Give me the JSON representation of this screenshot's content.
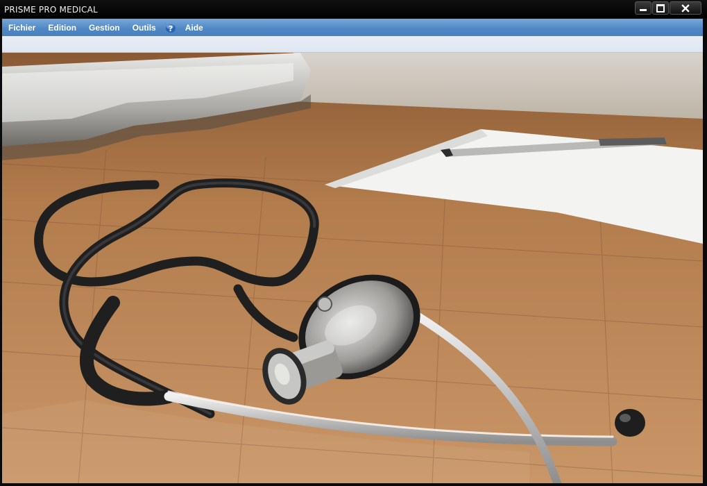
{
  "window": {
    "title": "PRISME PRO MEDICAL"
  },
  "menu": {
    "fichier": "Fichier",
    "edition": "Edition",
    "gestion": "Gestion",
    "outils": "Outils",
    "aide": "Aide"
  },
  "background": {
    "description_icon": "stethoscope-wallpaper"
  },
  "colors": {
    "menubar": "#4e86c4",
    "toolbar": "#e1e9f3",
    "titlebar": "#000000"
  }
}
